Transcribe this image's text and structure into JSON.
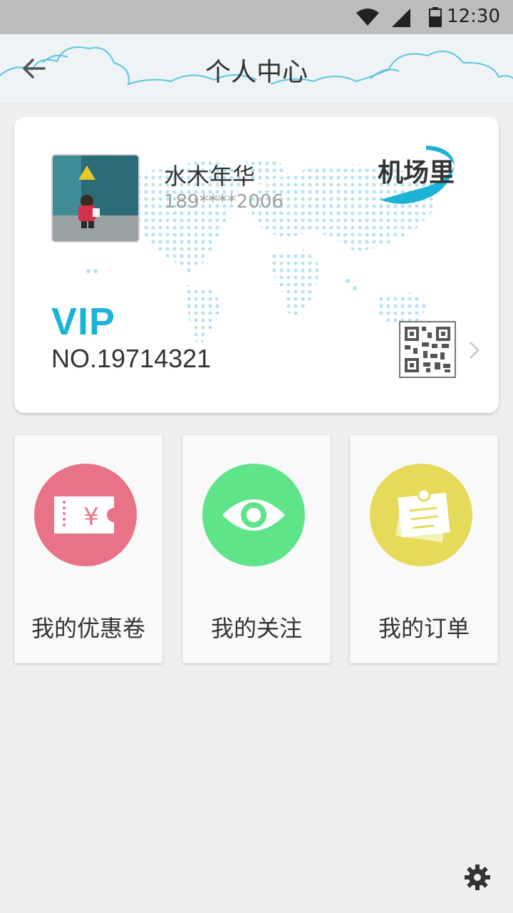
{
  "status_bar": {
    "time": "12:30",
    "icons": [
      "wifi-icon",
      "signal-icon",
      "battery-icon"
    ]
  },
  "header": {
    "title": "个人中心",
    "back_icon": "arrow-left-icon"
  },
  "profile": {
    "username": "水木年华",
    "phone": "189****2006",
    "brand_logo_text": "机场里",
    "vip_label": "VIP",
    "vip_number": "NO.19714321"
  },
  "tiles": [
    {
      "label": "我的优惠卷",
      "icon": "coupon-icon",
      "color": "#e87387"
    },
    {
      "label": "我的关注",
      "icon": "eye-icon",
      "color": "#5fe48a"
    },
    {
      "label": "我的订单",
      "icon": "notes-icon",
      "color": "#e6da5b"
    }
  ],
  "colors": {
    "accent": "#1cb3d7",
    "background": "#efefef"
  },
  "footer": {
    "settings_icon": "gear-icon"
  }
}
